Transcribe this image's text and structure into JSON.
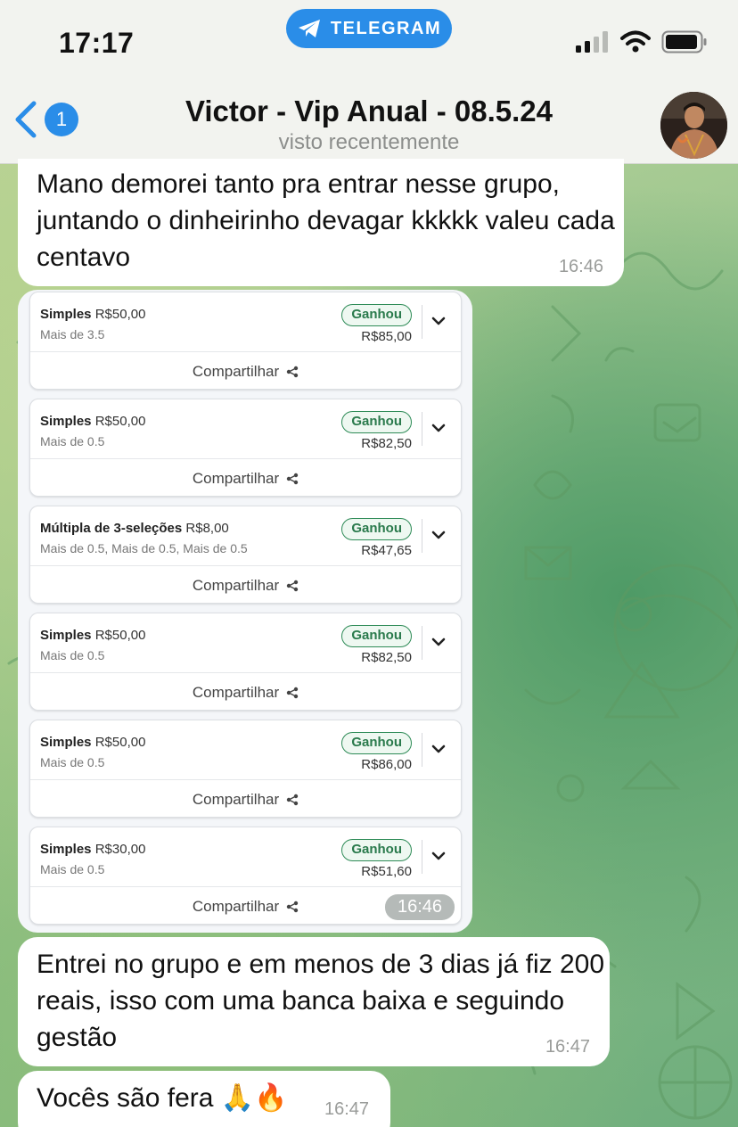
{
  "status_bar": {
    "time": "17:17",
    "app_pill": "TELEGRAM"
  },
  "header": {
    "back_badge": "1",
    "title": "Victor - Vip Anual - 08.5.24",
    "subtitle": "visto recentemente"
  },
  "messages": [
    {
      "text": "Mano demorei tanto pra entrar nesse grupo, juntando o dinheirinho devagar kkkkk valeu cada centavo",
      "time": "16:46"
    },
    {
      "image_time": "16:46"
    },
    {
      "text": "Entrei no grupo e em menos de 3 dias já fiz 200 reais, isso com uma banca baixa e seguindo gestão",
      "time": "16:47"
    },
    {
      "text": "Vocês são fera",
      "emoji": "🙏🔥",
      "time": "16:47"
    }
  ],
  "bets": [
    {
      "type": "Simples",
      "stake": "R$50,00",
      "market": "Mais de 3.5",
      "status": "Ganhou",
      "payout": "R$85,00",
      "share": "Compartilhar"
    },
    {
      "type": "Simples",
      "stake": "R$50,00",
      "market": "Mais de 0.5",
      "status": "Ganhou",
      "payout": "R$82,50",
      "share": "Compartilhar"
    },
    {
      "type": "Múltipla de 3-seleções",
      "stake": "R$8,00",
      "market": "Mais de 0.5, Mais de 0.5, Mais de 0.5",
      "status": "Ganhou",
      "payout": "R$47,65",
      "share": "Compartilhar"
    },
    {
      "type": "Simples",
      "stake": "R$50,00",
      "market": "Mais de 0.5",
      "status": "Ganhou",
      "payout": "R$82,50",
      "share": "Compartilhar"
    },
    {
      "type": "Simples",
      "stake": "R$50,00",
      "market": "Mais de 0.5",
      "status": "Ganhou",
      "payout": "R$86,00",
      "share": "Compartilhar"
    },
    {
      "type": "Simples",
      "stake": "R$30,00",
      "market": "Mais de 0.5",
      "status": "Ganhou",
      "payout": "R$51,60",
      "share": "Compartilhar"
    }
  ],
  "colors": {
    "accent": "#2a8de8",
    "win": "#2e8b57",
    "bubble": "#ffffff"
  }
}
